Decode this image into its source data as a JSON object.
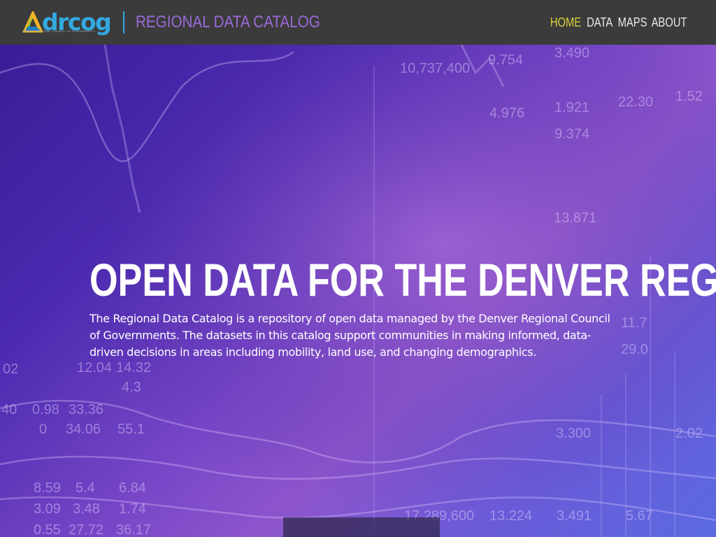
{
  "header": {
    "logo_text": "drcog",
    "logo_subtext": "DENVER REGIONAL COUNCIL OF GOVERNMENTS",
    "site_title": "REGIONAL DATA CATALOG",
    "nav": [
      {
        "label": "HOME",
        "active": true
      },
      {
        "label": "DATA",
        "active": false
      },
      {
        "label": "MAPS",
        "active": false
      },
      {
        "label": "ABOUT",
        "active": false
      }
    ]
  },
  "hero": {
    "title": "OPEN DATA FOR THE DENVER REGION",
    "description": "The Regional Data Catalog is a repository of open data managed by the Denver Regional Council of Governments. The datasets in this catalog support communities in making informed, data-driven decisions in areas including mobility, land use, and changing demographics.",
    "background_numbers": [
      "10,737,400",
      "9.754",
      "3.490",
      "4.976",
      "1.921",
      "9.374",
      "22.30",
      "1.52",
      "13.871",
      "11.7",
      "29.0",
      "3.300",
      "2.02",
      "17.289,600",
      "13.224",
      "3.491",
      "5.67",
      "8.59",
      "5.4",
      "6.84",
      "3.09",
      "3.48",
      "1.74",
      "0.55",
      "27.72",
      "36.17",
      "0.98",
      "33.36",
      "34.06",
      "55.1",
      "12.04",
      "14.32",
      "4.3",
      "40",
      "02",
      "0"
    ]
  },
  "colors": {
    "header_bg": "#3b3b3b",
    "nav_active": "#d8d23a",
    "title_purple": "#9a6ad8",
    "logo_blue": "#33a9e0"
  }
}
